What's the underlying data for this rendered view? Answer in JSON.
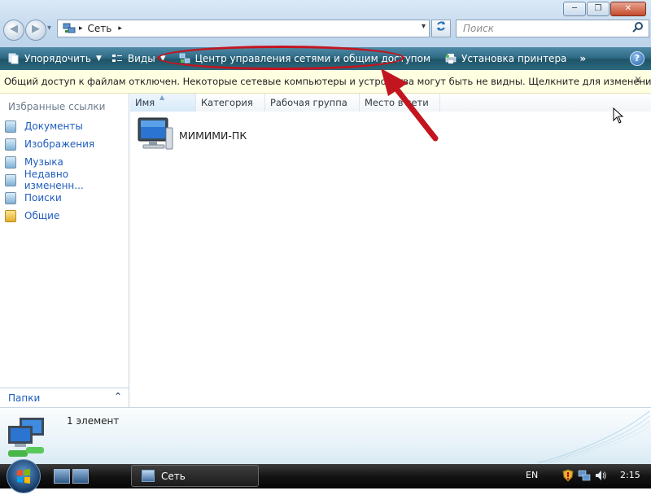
{
  "window": {
    "buttons": {
      "minimize": "─",
      "maximize": "❐",
      "close": "✕"
    }
  },
  "nav": {
    "back": "◀",
    "forward": "▶",
    "dropdown": "▾"
  },
  "address": {
    "location": "Сеть",
    "separator": "▸",
    "trailing_separator": "▸",
    "dropdown": "▾"
  },
  "search": {
    "placeholder": "Поиск",
    "icon": "search-icon"
  },
  "toolbar": {
    "organize_label": "Упорядочить",
    "views_label": "Виды",
    "network_center_label": "Центр управления сетями и общим доступом",
    "printer_label": "Установка принтера",
    "more_label": "»",
    "help_label": "?"
  },
  "infobar": {
    "text": "Общий доступ к файлам отключен. Некоторые сетевые компьютеры и устройства могут быть не видны. Щелкните для изменения...",
    "close": "x"
  },
  "sidebar": {
    "title": "Избранные ссылки",
    "items": [
      {
        "label": "Документы",
        "icon": "documents-icon"
      },
      {
        "label": "Изображения",
        "icon": "pictures-icon"
      },
      {
        "label": "Музыка",
        "icon": "music-icon"
      },
      {
        "label": "Недавно измененн...",
        "icon": "recent-icon"
      },
      {
        "label": "Поиски",
        "icon": "searches-icon"
      },
      {
        "label": "Общие",
        "icon": "public-folder-icon"
      }
    ],
    "folders_label": "Папки",
    "folders_toggle": "⌃"
  },
  "columns": [
    "Имя",
    "Категория",
    "Рабочая группа",
    "Место в сети"
  ],
  "items": [
    {
      "name": "МИМИМИ-ПК",
      "icon": "computer-icon"
    }
  ],
  "details": {
    "count_text": "1 элемент"
  },
  "taskbar": {
    "active_window": "Сеть",
    "language": "EN",
    "clock": "2:15"
  },
  "colors": {
    "command_bar": "#2f6b85",
    "annotation": "#c3151f",
    "infobar_bg": "#ffffe1",
    "link": "#1f5dbd"
  }
}
